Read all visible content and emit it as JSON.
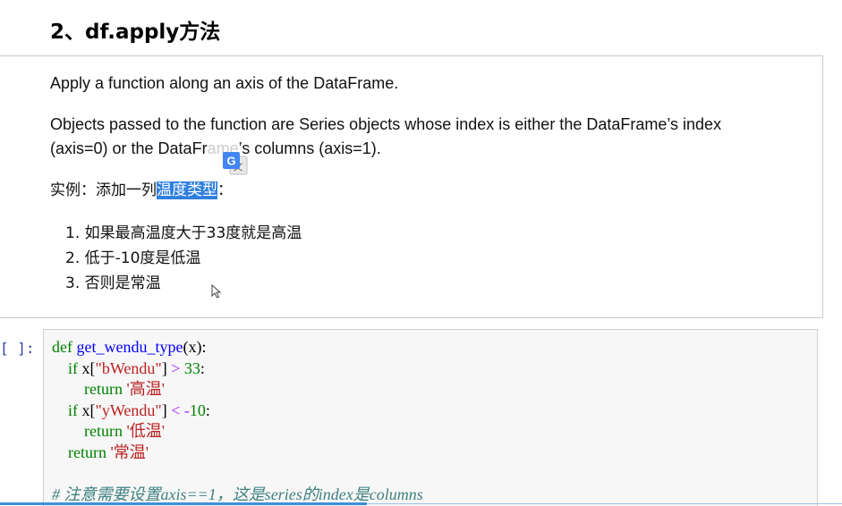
{
  "heading": "2、df.apply方法",
  "markdown": {
    "p1": "Apply a function along an axis of the DataFrame.",
    "p2_line1": "Objects passed to the function are Series objects whose index is either the DataFrame’s index",
    "p2_line2_a": "(axis=0) or the DataFr",
    "p2_line2_hidden": "ame",
    "p2_line2_b": "’s columns (axis=1).",
    "p3_prefix": "实例：添加一列",
    "p3_highlight": "温度类型",
    "p3_suffix": "：",
    "list": [
      "1. 如果最高温度大于33度就是高温",
      "2. 低于-10度是低温",
      "3. 否则是常温"
    ]
  },
  "icons": {
    "translate": "google-translate-icon",
    "cursor": "mouse-cursor-icon"
  },
  "code_cell": {
    "prompt": "[ ]:",
    "line1": {
      "kw": "def",
      "fn": "get_wendu_type",
      "rest": "(x):"
    },
    "line2": {
      "kw": "if",
      "a": " x[",
      "str": "\"bWendu\"",
      "b": "] ",
      "op": ">",
      "c": " ",
      "num": "33",
      "d": ":"
    },
    "line3": {
      "kw": "return",
      "str": "'高温'"
    },
    "line4": {
      "kw": "if",
      "a": " x[",
      "str": "\"yWendu\"",
      "b": "] ",
      "op": "<",
      "c": " ",
      "op2": "-",
      "num": "10",
      "d": ":"
    },
    "line5": {
      "kw": "return",
      "str": "'低温'"
    },
    "line6": {
      "kw": "return",
      "str": "'常温'"
    },
    "comment": "# 注意需要设置axis==1，这是series的index是columns"
  },
  "colors": {
    "highlight": "#2f7fe0",
    "keyword": "#008000",
    "function": "#0000ff",
    "string": "#ba2121",
    "comment": "#408080"
  }
}
